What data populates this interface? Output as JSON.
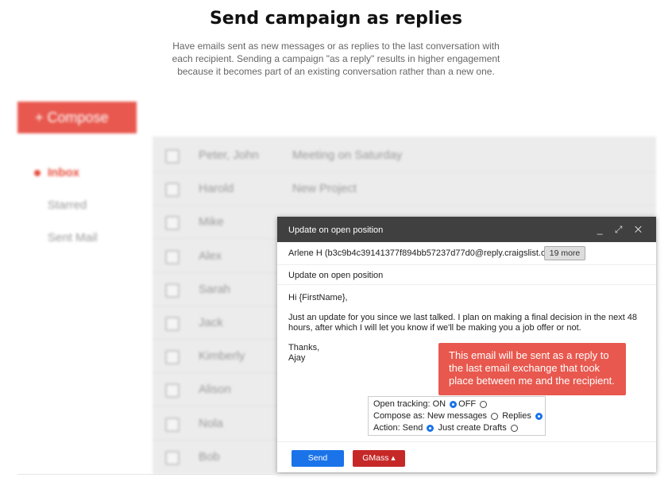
{
  "header": {
    "title": "Send campaign as replies",
    "description_line1": "Have emails sent as new messages or as replies to the last conversation with",
    "description_line2": "each recipient. Sending a campaign \"as a reply\" results in higher engagement",
    "description_line3": "because it becomes part of an existing conversation rather than a new one."
  },
  "mail_client": {
    "compose_label": "+ Compose",
    "nav": [
      {
        "label": "Inbox"
      },
      {
        "label": "Starred"
      },
      {
        "label": "Sent Mail"
      }
    ],
    "rows": [
      {
        "sender": "Peter, John",
        "subject": "Meeting on Saturday"
      },
      {
        "sender": "Harold",
        "subject": "New Project"
      },
      {
        "sender": "Mike",
        "subject": ""
      },
      {
        "sender": "Alex",
        "subject": ""
      },
      {
        "sender": "Sarah",
        "subject": ""
      },
      {
        "sender": "Jack",
        "subject": ""
      },
      {
        "sender": "Kimberly",
        "subject": ""
      },
      {
        "sender": "Alison",
        "subject": ""
      },
      {
        "sender": "Nola",
        "subject": ""
      },
      {
        "sender": "Bob",
        "subject": ""
      }
    ]
  },
  "compose_window": {
    "title": "Update on open position",
    "icons": [
      "minimize-icon",
      "expand-icon",
      "close-icon"
    ],
    "minimize": "_",
    "expand": "⤢",
    "close": "✕",
    "to": "Arlene H (b3c9b4c39141377f894bb57237d77d0@reply.craigslist.org)",
    "more_label": "19 more",
    "subject": "Update on open position",
    "greeting": "Hi {FirstName},",
    "body": "Just an update for you since we last talked. I plan on making a final decision in the next 48 hours, after which I will let you know if we'll be making you a job offer or not.",
    "signoff_1": "Thanks,",
    "signoff_2": "Ajay",
    "callout": "This email will be sent as a reply to the last email exchange that took place between me and the recipient.",
    "options": {
      "tracking_label": "Open tracking: ON",
      "tracking_off": "OFF",
      "compose_label": "Compose as: New messages",
      "compose_replies": "Replies",
      "action_label": "Action: Send",
      "action_drafts": "Just create Drafts"
    },
    "send_label": "Send",
    "gmass_label": "GMass ▴"
  },
  "colors": {
    "accent_red": "#e8584e",
    "send_blue": "#1a73e8",
    "gmass_red": "#c62828",
    "header_dark": "#404040"
  }
}
